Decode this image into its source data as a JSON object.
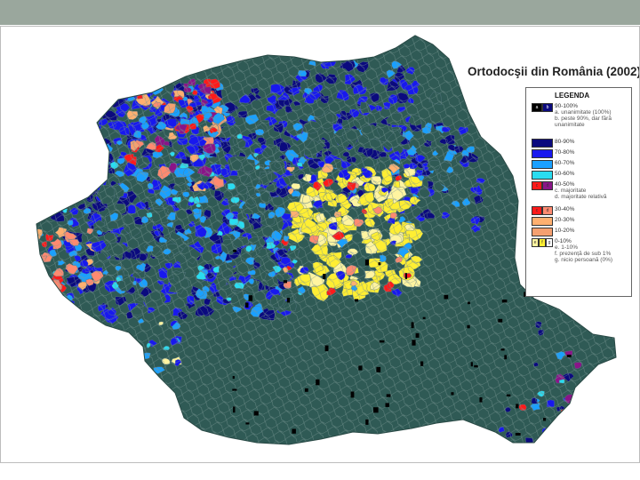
{
  "map": {
    "title": "Ortodocşii din România (2002)",
    "colors": {
      "base": "#2f5a55",
      "border": "#6f8f8b",
      "navy": "#0b0a7e",
      "blue": "#1818ee",
      "azure": "#1aa0ff",
      "cyan": "#2adcf0",
      "red": "#ff1a1a",
      "purple": "#8a1488",
      "salmon": "#ff8a70",
      "orange": "#ffb070",
      "peach": "#f5a070",
      "lightyellow": "#fff4a0",
      "yellow": "#ffee33",
      "black": "#000000"
    }
  },
  "legend": {
    "title": "LEGENDA",
    "rows": [
      {
        "label": "90-100%",
        "sub": [
          "a. unanimitate (100%)",
          "b. peste 90%, dar fără",
          "unanimitate"
        ],
        "labels": [
          "a",
          "b"
        ],
        "colors": [
          "#000000",
          "#0b0a7e"
        ]
      },
      {
        "label": "80-90%",
        "sub": [],
        "labels": [],
        "colors": [
          "#0b0a7e"
        ]
      },
      {
        "label": "70-80%",
        "sub": [],
        "labels": [],
        "colors": [
          "#1818ee"
        ]
      },
      {
        "label": "60-70%",
        "sub": [],
        "labels": [],
        "colors": [
          "#1aa0ff"
        ]
      },
      {
        "label": "50-60%",
        "sub": [],
        "labels": [],
        "colors": [
          "#2adcf0"
        ]
      },
      {
        "label": "40-50%",
        "sub": [
          "c. majoritate",
          "d. majoritate relativă"
        ],
        "labels": [
          "c",
          "d"
        ],
        "colors": [
          "#ff1a1a",
          "#8a1488"
        ]
      },
      {
        "label": "30-40%",
        "sub": [],
        "labels": [
          "c",
          "d"
        ],
        "colors": [
          "#ff1a1a",
          "#ff8a70"
        ]
      },
      {
        "label": "20-30%",
        "sub": [],
        "labels": [],
        "colors": [
          "#ffb070"
        ]
      },
      {
        "label": "10-20%",
        "sub": [],
        "labels": [],
        "colors": [
          "#f5a070"
        ]
      },
      {
        "label": "0-10%",
        "sub": [
          "e. 1-10%",
          "f. prezență de sub 1%",
          "g. nicio persoană (0%)"
        ],
        "labels": [
          "e",
          "f",
          "g"
        ],
        "colors": [
          "#fff4a0",
          "#ffee33",
          "#ffffff"
        ]
      }
    ]
  }
}
